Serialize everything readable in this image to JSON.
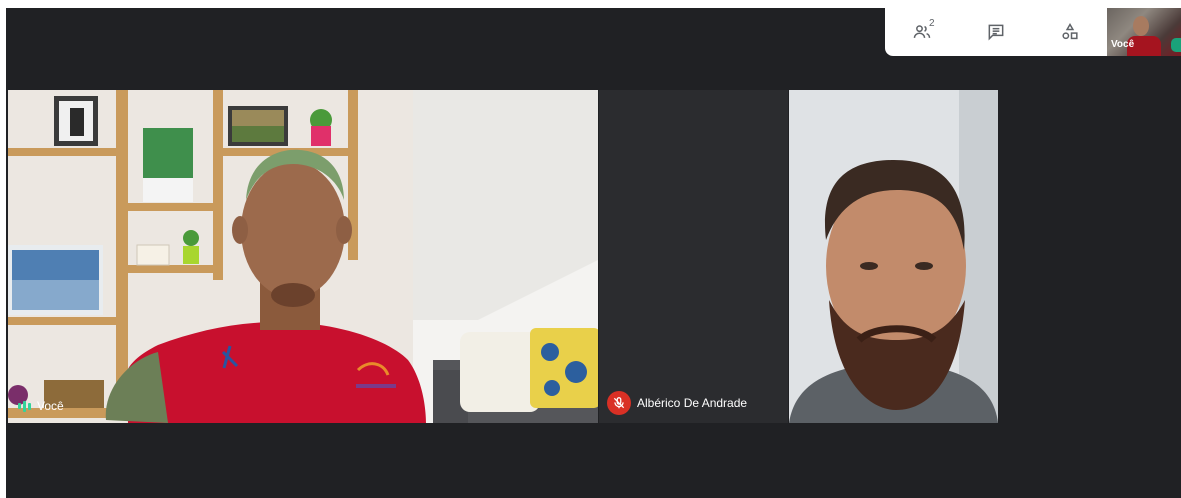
{
  "top_panel": {
    "participants_icon": "people-icon",
    "participant_count": "2",
    "chat_icon": "chat-icon",
    "activities_icon": "activities-icon",
    "self_thumb_label": "Você"
  },
  "tiles": {
    "self": {
      "label": "Você",
      "audio_icon": "audio-level-icon"
    },
    "muted_participant": {
      "label": "Albérico De Andrade",
      "mic_icon": "mic-off-icon"
    }
  },
  "colors": {
    "background": "#202124",
    "mic_off": "#d93025",
    "audio_active": "#34d399"
  }
}
